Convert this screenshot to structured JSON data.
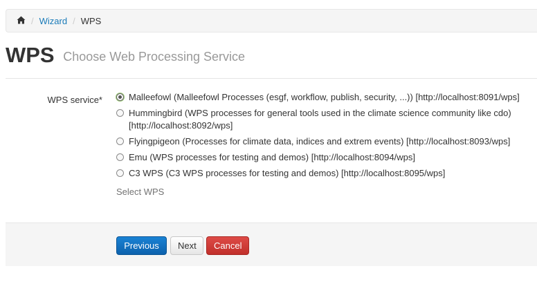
{
  "breadcrumb": {
    "home_icon": "home-icon",
    "separator": "/",
    "items": [
      {
        "label": "Wizard",
        "is_link": true
      },
      {
        "label": "WPS",
        "is_link": false
      }
    ]
  },
  "header": {
    "title": "WPS",
    "subtitle": "Choose Web Processing Service"
  },
  "form": {
    "field_label": "WPS service*",
    "selected_index": 0,
    "options": [
      {
        "label": "Malleefowl (Malleefowl Processes (esgf, workflow, publish, security, ...)) [http://localhost:8091/wps]"
      },
      {
        "label": "Hummingbird (WPS processes for general tools used in the climate science community like cdo) [http://localhost:8092/wps]"
      },
      {
        "label": "Flyingpigeon (Processes for climate data, indices and extrem events) [http://localhost:8093/wps]"
      },
      {
        "label": "Emu (WPS processes for testing and demos) [http://localhost:8094/wps]"
      },
      {
        "label": "C3 WPS (C3 WPS processes for testing and demos) [http://localhost:8095/wps]"
      }
    ],
    "help_text": "Select WPS"
  },
  "actions": {
    "previous_label": "Previous",
    "next_label": "Next",
    "cancel_label": "Cancel"
  },
  "colors": {
    "link": "#1a7bb9",
    "primary": "#1a82d4",
    "danger": "#d9534f"
  }
}
